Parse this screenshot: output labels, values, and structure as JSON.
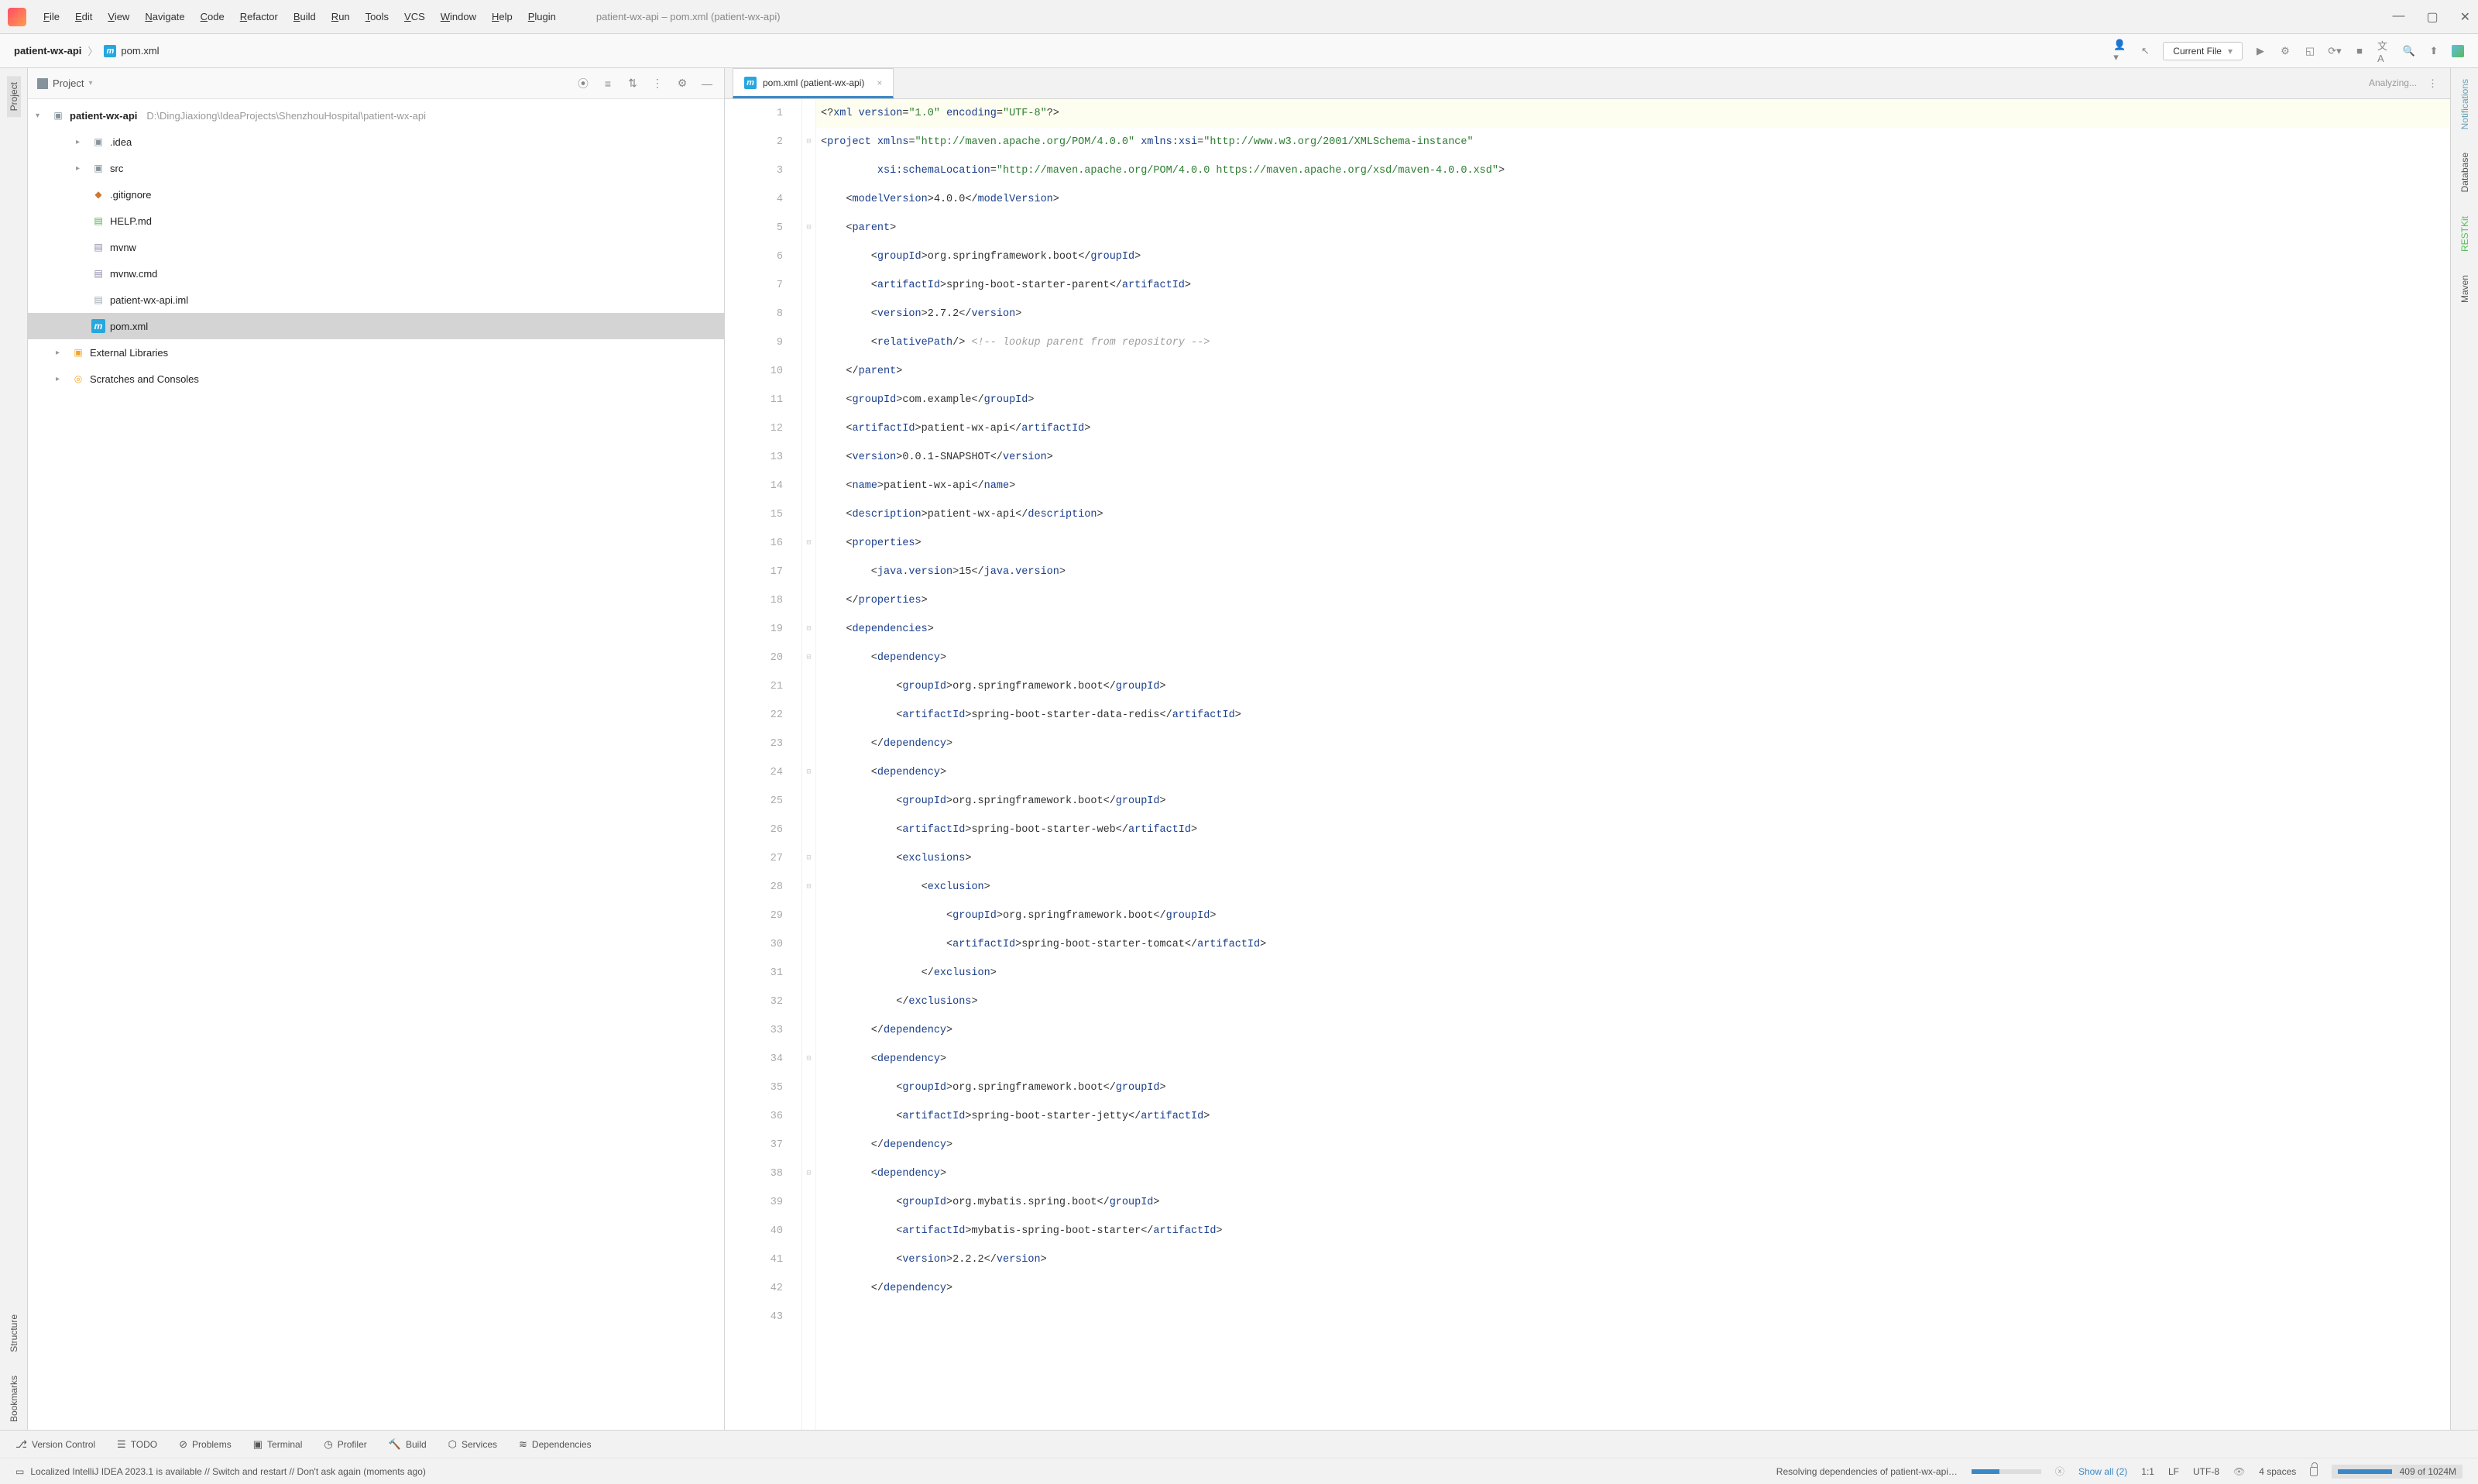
{
  "window": {
    "title": "patient-wx-api – pom.xml (patient-wx-api)"
  },
  "menu": {
    "items": [
      "File",
      "Edit",
      "View",
      "Navigate",
      "Code",
      "Refactor",
      "Build",
      "Run",
      "Tools",
      "VCS",
      "Window",
      "Help",
      "Plugin"
    ]
  },
  "breadcrumb": {
    "project": "patient-wx-api",
    "file": "pom.xml"
  },
  "run_config": {
    "label": "Current File"
  },
  "tool_window": {
    "title": "Project"
  },
  "tree": {
    "root": {
      "name": "patient-wx-api",
      "path": "D:\\DingJiaxiong\\IdeaProjects\\ShenzhouHospital\\patient-wx-api"
    },
    "nodes": [
      {
        "name": ".idea",
        "type": "folder",
        "expandable": true
      },
      {
        "name": "src",
        "type": "folder",
        "expandable": true
      },
      {
        "name": ".gitignore",
        "type": "git"
      },
      {
        "name": "HELP.md",
        "type": "md"
      },
      {
        "name": "mvnw",
        "type": "cmd"
      },
      {
        "name": "mvnw.cmd",
        "type": "cmd"
      },
      {
        "name": "patient-wx-api.iml",
        "type": "iml"
      },
      {
        "name": "pom.xml",
        "type": "mvn",
        "selected": true
      }
    ],
    "external_libs": "External Libraries",
    "scratches": "Scratches and Consoles"
  },
  "editor": {
    "tab_label": "pom.xml (patient-wx-api)",
    "analyzing": "Analyzing...",
    "lines": 43
  },
  "code_tokens": [
    [
      [
        "punc",
        "<?"
      ],
      [
        "tag",
        "xml "
      ],
      [
        "attr",
        "version"
      ],
      [
        "punc",
        "="
      ],
      [
        "str",
        "\"1.0\""
      ],
      [
        "punc",
        " "
      ],
      [
        "attr",
        "encoding"
      ],
      [
        "punc",
        "="
      ],
      [
        "str",
        "\"UTF-8\""
      ],
      [
        "punc",
        "?>"
      ]
    ],
    [
      [
        "punc",
        "<"
      ],
      [
        "tag",
        "project "
      ],
      [
        "attr",
        "xmlns"
      ],
      [
        "punc",
        "="
      ],
      [
        "str",
        "\"http://maven.apache.org/POM/4.0.0\""
      ],
      [
        "punc",
        " "
      ],
      [
        "attr",
        "xmlns"
      ],
      [
        "punc",
        ":"
      ],
      [
        "ns",
        "xsi"
      ],
      [
        "punc",
        "="
      ],
      [
        "str",
        "\"http://www.w3.org/2001/XMLSchema-instance\""
      ]
    ],
    [
      [
        "punc",
        "         "
      ],
      [
        "ns",
        "xsi"
      ],
      [
        "punc",
        ":"
      ],
      [
        "attr",
        "schemaLocation"
      ],
      [
        "punc",
        "="
      ],
      [
        "str",
        "\"http://maven.apache.org/POM/4.0.0 https://maven.apache.org/xsd/maven-4.0.0.xsd\""
      ],
      [
        "punc",
        ">"
      ]
    ],
    [
      [
        "punc",
        "    <"
      ],
      [
        "tag",
        "modelVersion"
      ],
      [
        "punc",
        ">"
      ],
      [
        "txt",
        "4.0.0"
      ],
      [
        "punc",
        "</"
      ],
      [
        "tag",
        "modelVersion"
      ],
      [
        "punc",
        ">"
      ]
    ],
    [
      [
        "punc",
        "    <"
      ],
      [
        "tag",
        "parent"
      ],
      [
        "punc",
        ">"
      ]
    ],
    [
      [
        "punc",
        "        <"
      ],
      [
        "tag",
        "groupId"
      ],
      [
        "punc",
        ">"
      ],
      [
        "txt",
        "org.springframework.boot"
      ],
      [
        "punc",
        "</"
      ],
      [
        "tag",
        "groupId"
      ],
      [
        "punc",
        ">"
      ]
    ],
    [
      [
        "punc",
        "        <"
      ],
      [
        "tag",
        "artifactId"
      ],
      [
        "punc",
        ">"
      ],
      [
        "txt",
        "spring-boot-starter-parent"
      ],
      [
        "punc",
        "</"
      ],
      [
        "tag",
        "artifactId"
      ],
      [
        "punc",
        ">"
      ]
    ],
    [
      [
        "punc",
        "        <"
      ],
      [
        "tag",
        "version"
      ],
      [
        "punc",
        ">"
      ],
      [
        "txt",
        "2.7.2"
      ],
      [
        "punc",
        "</"
      ],
      [
        "tag",
        "version"
      ],
      [
        "punc",
        ">"
      ]
    ],
    [
      [
        "punc",
        "        <"
      ],
      [
        "tag",
        "relativePath"
      ],
      [
        "punc",
        "/> "
      ],
      [
        "cmt",
        "<!-- lookup parent from repository -->"
      ]
    ],
    [
      [
        "punc",
        "    </"
      ],
      [
        "tag",
        "parent"
      ],
      [
        "punc",
        ">"
      ]
    ],
    [
      [
        "punc",
        "    <"
      ],
      [
        "tag",
        "groupId"
      ],
      [
        "punc",
        ">"
      ],
      [
        "txt",
        "com.example"
      ],
      [
        "punc",
        "</"
      ],
      [
        "tag",
        "groupId"
      ],
      [
        "punc",
        ">"
      ]
    ],
    [
      [
        "punc",
        "    <"
      ],
      [
        "tag",
        "artifactId"
      ],
      [
        "punc",
        ">"
      ],
      [
        "txt",
        "patient-wx-api"
      ],
      [
        "punc",
        "</"
      ],
      [
        "tag",
        "artifactId"
      ],
      [
        "punc",
        ">"
      ]
    ],
    [
      [
        "punc",
        "    <"
      ],
      [
        "tag",
        "version"
      ],
      [
        "punc",
        ">"
      ],
      [
        "txt",
        "0.0.1-SNAPSHOT"
      ],
      [
        "punc",
        "</"
      ],
      [
        "tag",
        "version"
      ],
      [
        "punc",
        ">"
      ]
    ],
    [
      [
        "punc",
        "    <"
      ],
      [
        "tag",
        "name"
      ],
      [
        "punc",
        ">"
      ],
      [
        "txt",
        "patient-wx-api"
      ],
      [
        "punc",
        "</"
      ],
      [
        "tag",
        "name"
      ],
      [
        "punc",
        ">"
      ]
    ],
    [
      [
        "punc",
        "    <"
      ],
      [
        "tag",
        "description"
      ],
      [
        "punc",
        ">"
      ],
      [
        "txt",
        "patient-wx-api"
      ],
      [
        "punc",
        "</"
      ],
      [
        "tag",
        "description"
      ],
      [
        "punc",
        ">"
      ]
    ],
    [
      [
        "punc",
        "    <"
      ],
      [
        "tag",
        "properties"
      ],
      [
        "punc",
        ">"
      ]
    ],
    [
      [
        "punc",
        "        <"
      ],
      [
        "tag",
        "java.version"
      ],
      [
        "punc",
        ">"
      ],
      [
        "txt",
        "15"
      ],
      [
        "punc",
        "</"
      ],
      [
        "tag",
        "java.version"
      ],
      [
        "punc",
        ">"
      ]
    ],
    [
      [
        "punc",
        "    </"
      ],
      [
        "tag",
        "properties"
      ],
      [
        "punc",
        ">"
      ]
    ],
    [
      [
        "punc",
        "    <"
      ],
      [
        "tag",
        "dependencies"
      ],
      [
        "punc",
        ">"
      ]
    ],
    [
      [
        "punc",
        "        <"
      ],
      [
        "tag",
        "dependency"
      ],
      [
        "punc",
        ">"
      ]
    ],
    [
      [
        "punc",
        "            <"
      ],
      [
        "tag",
        "groupId"
      ],
      [
        "punc",
        ">"
      ],
      [
        "txt",
        "org.springframework.boot"
      ],
      [
        "punc",
        "</"
      ],
      [
        "tag",
        "groupId"
      ],
      [
        "punc",
        ">"
      ]
    ],
    [
      [
        "punc",
        "            <"
      ],
      [
        "tag",
        "artifactId"
      ],
      [
        "punc",
        ">"
      ],
      [
        "txt",
        "spring-boot-starter-data-redis"
      ],
      [
        "punc",
        "</"
      ],
      [
        "tag",
        "artifactId"
      ],
      [
        "punc",
        ">"
      ]
    ],
    [
      [
        "punc",
        "        </"
      ],
      [
        "tag",
        "dependency"
      ],
      [
        "punc",
        ">"
      ]
    ],
    [
      [
        "punc",
        "        <"
      ],
      [
        "tag",
        "dependency"
      ],
      [
        "punc",
        ">"
      ]
    ],
    [
      [
        "punc",
        "            <"
      ],
      [
        "tag",
        "groupId"
      ],
      [
        "punc",
        ">"
      ],
      [
        "txt",
        "org.springframework.boot"
      ],
      [
        "punc",
        "</"
      ],
      [
        "tag",
        "groupId"
      ],
      [
        "punc",
        ">"
      ]
    ],
    [
      [
        "punc",
        "            <"
      ],
      [
        "tag",
        "artifactId"
      ],
      [
        "punc",
        ">"
      ],
      [
        "txt",
        "spring-boot-starter-web"
      ],
      [
        "punc",
        "</"
      ],
      [
        "tag",
        "artifactId"
      ],
      [
        "punc",
        ">"
      ]
    ],
    [
      [
        "punc",
        "            <"
      ],
      [
        "tag",
        "exclusions"
      ],
      [
        "punc",
        ">"
      ]
    ],
    [
      [
        "punc",
        "                <"
      ],
      [
        "tag",
        "exclusion"
      ],
      [
        "punc",
        ">"
      ]
    ],
    [
      [
        "punc",
        "                    <"
      ],
      [
        "tag",
        "groupId"
      ],
      [
        "punc",
        ">"
      ],
      [
        "txt",
        "org.springframework.boot"
      ],
      [
        "punc",
        "</"
      ],
      [
        "tag",
        "groupId"
      ],
      [
        "punc",
        ">"
      ]
    ],
    [
      [
        "punc",
        "                    <"
      ],
      [
        "tag",
        "artifactId"
      ],
      [
        "punc",
        ">"
      ],
      [
        "txt",
        "spring-boot-starter-tomcat"
      ],
      [
        "punc",
        "</"
      ],
      [
        "tag",
        "artifactId"
      ],
      [
        "punc",
        ">"
      ]
    ],
    [
      [
        "punc",
        "                </"
      ],
      [
        "tag",
        "exclusion"
      ],
      [
        "punc",
        ">"
      ]
    ],
    [
      [
        "punc",
        "            </"
      ],
      [
        "tag",
        "exclusions"
      ],
      [
        "punc",
        ">"
      ]
    ],
    [
      [
        "punc",
        "        </"
      ],
      [
        "tag",
        "dependency"
      ],
      [
        "punc",
        ">"
      ]
    ],
    [
      [
        "punc",
        "        <"
      ],
      [
        "tag",
        "dependency"
      ],
      [
        "punc",
        ">"
      ]
    ],
    [
      [
        "punc",
        "            <"
      ],
      [
        "tag",
        "groupId"
      ],
      [
        "punc",
        ">"
      ],
      [
        "txt",
        "org.springframework.boot"
      ],
      [
        "punc",
        "</"
      ],
      [
        "tag",
        "groupId"
      ],
      [
        "punc",
        ">"
      ]
    ],
    [
      [
        "punc",
        "            <"
      ],
      [
        "tag",
        "artifactId"
      ],
      [
        "punc",
        ">"
      ],
      [
        "txt",
        "spring-boot-starter-jetty"
      ],
      [
        "punc",
        "</"
      ],
      [
        "tag",
        "artifactId"
      ],
      [
        "punc",
        ">"
      ]
    ],
    [
      [
        "punc",
        "        </"
      ],
      [
        "tag",
        "dependency"
      ],
      [
        "punc",
        ">"
      ]
    ],
    [
      [
        "punc",
        "        <"
      ],
      [
        "tag",
        "dependency"
      ],
      [
        "punc",
        ">"
      ]
    ],
    [
      [
        "punc",
        "            <"
      ],
      [
        "tag",
        "groupId"
      ],
      [
        "punc",
        ">"
      ],
      [
        "txt",
        "org.mybatis.spring.boot"
      ],
      [
        "punc",
        "</"
      ],
      [
        "tag",
        "groupId"
      ],
      [
        "punc",
        ">"
      ]
    ],
    [
      [
        "punc",
        "            <"
      ],
      [
        "tag",
        "artifactId"
      ],
      [
        "punc",
        ">"
      ],
      [
        "txt",
        "mybatis-spring-boot-starter"
      ],
      [
        "punc",
        "</"
      ],
      [
        "tag",
        "artifactId"
      ],
      [
        "punc",
        ">"
      ]
    ],
    [
      [
        "punc",
        "            <"
      ],
      [
        "tag",
        "version"
      ],
      [
        "punc",
        ">"
      ],
      [
        "txt",
        "2.2.2"
      ],
      [
        "punc",
        "</"
      ],
      [
        "tag",
        "version"
      ],
      [
        "punc",
        ">"
      ]
    ],
    [
      [
        "punc",
        "        </"
      ],
      [
        "tag",
        "dependency"
      ],
      [
        "punc",
        ">"
      ]
    ],
    [
      [
        "txt",
        ""
      ]
    ]
  ],
  "left_stripe": {
    "top": [
      "Project"
    ],
    "bottom": [
      "Structure",
      "Bookmarks"
    ]
  },
  "right_stripe": [
    "Notifications",
    "Database",
    "RESTKit",
    "Maven"
  ],
  "right_stripe_color": [
    "#6a9fb5",
    "#6a9fb5",
    "#5fbf5f",
    "#888"
  ],
  "bottom_tabs": [
    {
      "icon": "⎇",
      "label": "Version Control"
    },
    {
      "icon": "☰",
      "label": "TODO"
    },
    {
      "icon": "⊘",
      "label": "Problems"
    },
    {
      "icon": "▣",
      "label": "Terminal"
    },
    {
      "icon": "◷",
      "label": "Profiler"
    },
    {
      "icon": "🔨",
      "label": "Build"
    },
    {
      "icon": "⬡",
      "label": "Services"
    },
    {
      "icon": "≋",
      "label": "Dependencies"
    }
  ],
  "status": {
    "left_msg": "Localized IntelliJ IDEA 2023.1 is available // Switch and restart // Don't ask again (moments ago)",
    "resolving": "Resolving dependencies of patient-wx-api…",
    "show_all": "Show all (2)",
    "cursor": "1:1",
    "eol": "LF",
    "enc": "UTF-8",
    "indent": "4 spaces",
    "mem": "409 of 1024M"
  }
}
